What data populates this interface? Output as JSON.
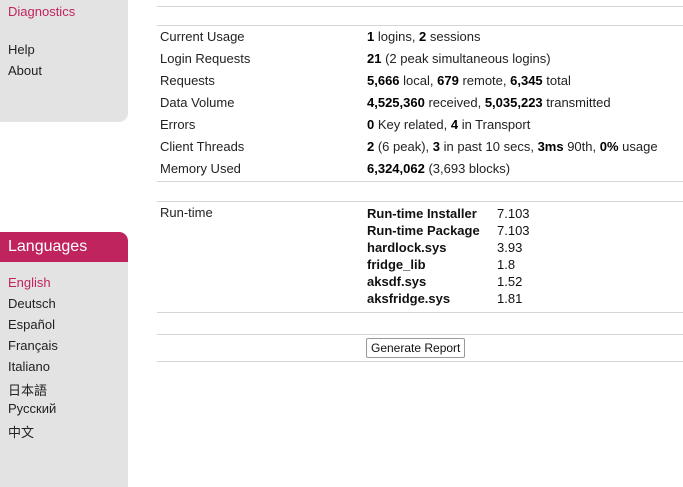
{
  "sidebar": {
    "top_items": [
      {
        "label": "Diagnostics",
        "active": true
      },
      {
        "label": "Help",
        "active": false
      },
      {
        "label": "About",
        "active": false
      }
    ],
    "languages_title": "Languages",
    "languages": [
      {
        "label": "English",
        "active": true
      },
      {
        "label": "Deutsch",
        "active": false
      },
      {
        "label": "Español",
        "active": false
      },
      {
        "label": "Français",
        "active": false
      },
      {
        "label": "Italiano",
        "active": false
      },
      {
        "label": "日本語",
        "active": false
      },
      {
        "label": "Русский",
        "active": false
      },
      {
        "label": "中文",
        "active": false
      }
    ]
  },
  "stats": [
    {
      "label": "Current Usage",
      "parts": [
        [
          "1",
          true
        ],
        [
          " logins, ",
          false
        ],
        [
          "2",
          true
        ],
        [
          " sessions",
          false
        ]
      ]
    },
    {
      "label": "Login Requests",
      "parts": [
        [
          "21",
          true
        ],
        [
          " (2 peak simultaneous logins)",
          false
        ]
      ]
    },
    {
      "label": "Requests",
      "parts": [
        [
          "5,666",
          true
        ],
        [
          " local, ",
          false
        ],
        [
          "679",
          true
        ],
        [
          " remote, ",
          false
        ],
        [
          "6,345",
          true
        ],
        [
          " total",
          false
        ]
      ]
    },
    {
      "label": "Data Volume",
      "parts": [
        [
          "4,525,360",
          true
        ],
        [
          " received, ",
          false
        ],
        [
          "5,035,223",
          true
        ],
        [
          " transmitted",
          false
        ]
      ]
    },
    {
      "label": "Errors",
      "parts": [
        [
          "0",
          true
        ],
        [
          " Key related, ",
          false
        ],
        [
          "4",
          true
        ],
        [
          " in Transport",
          false
        ]
      ]
    },
    {
      "label": "Client Threads",
      "parts": [
        [
          "2",
          true
        ],
        [
          " (6 peak), ",
          false
        ],
        [
          "3",
          true
        ],
        [
          " in past 10 secs, ",
          false
        ],
        [
          "3ms",
          true
        ],
        [
          " 90th, ",
          false
        ],
        [
          "0%",
          true
        ],
        [
          " usage",
          false
        ]
      ]
    },
    {
      "label": "Memory Used",
      "parts": [
        [
          "6,324,062",
          true
        ],
        [
          " (3,693 blocks)",
          false
        ]
      ]
    }
  ],
  "runtime": {
    "label": "Run-time",
    "items": [
      {
        "name": "Run-time Installer",
        "version": "7.103"
      },
      {
        "name": "Run-time Package",
        "version": "7.103"
      },
      {
        "name": "hardlock.sys",
        "version": "3.93"
      },
      {
        "name": "fridge_lib",
        "version": "1.8"
      },
      {
        "name": "aksdf.sys",
        "version": "1.52"
      },
      {
        "name": "aksfridge.sys",
        "version": "1.81"
      }
    ]
  },
  "report_button_label": "Generate Report",
  "colors": {
    "accent": "#c0245f",
    "sidebar_bg": "#e3e3e3",
    "rule": "#d6d6d6"
  }
}
